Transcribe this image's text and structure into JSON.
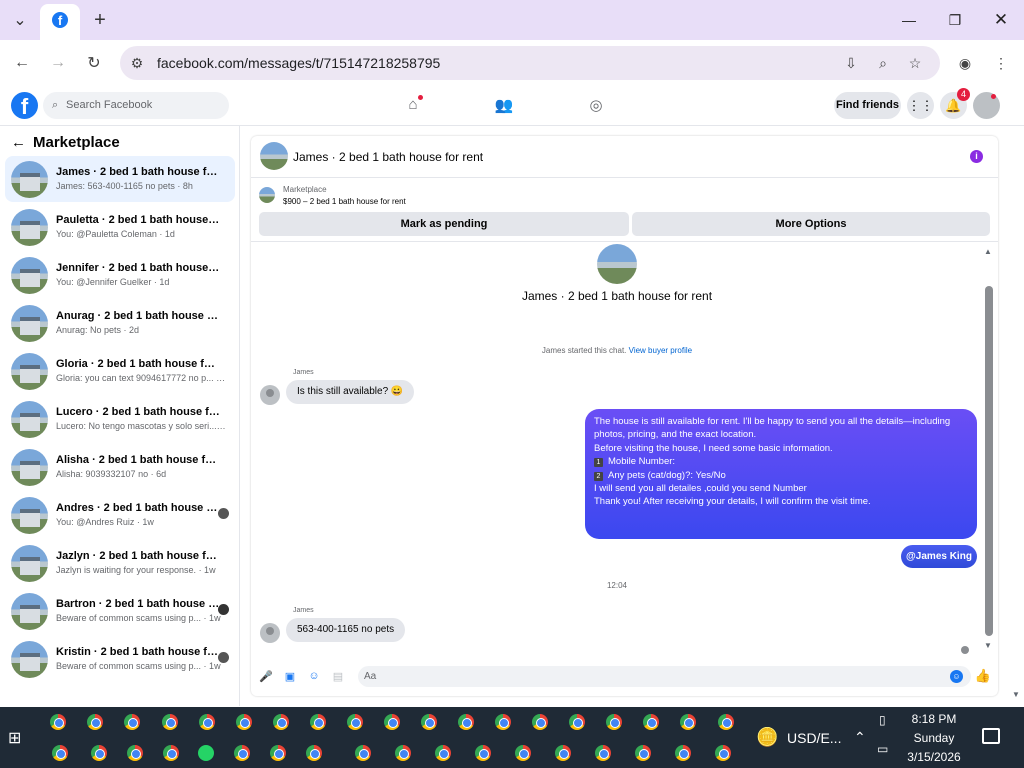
{
  "browser": {
    "url": "facebook.com/messages/t/715147218258795"
  },
  "fb": {
    "search_placeholder": "Search Facebook",
    "find_friends": "Find friends",
    "notification_count": "4"
  },
  "sidebar": {
    "title": "Marketplace",
    "conversations": [
      {
        "name": "James · 2 bed 1 bath house for rent",
        "preview": "James: 563-400-1165 no pets · 8h"
      },
      {
        "name": "Pauletta · 2 bed 1 bath house for r...",
        "preview": "You: @Pauletta Coleman · 1d"
      },
      {
        "name": "Jennifer · 2 bed 1 bath house for r...",
        "preview": "You: @Jennifer Guelker · 1d"
      },
      {
        "name": "Anurag · 2 bed 1 bath house for rent",
        "preview": "Anurag: No pets · 2d"
      },
      {
        "name": "Gloria · 2 bed 1 bath house for rent",
        "preview": "Gloria: you can text 9094617772 no p... · 5d"
      },
      {
        "name": "Lucero · 2 bed 1 bath house for rent",
        "preview": "Lucero: No tengo mascotas y solo seri... · 6d"
      },
      {
        "name": "Alisha · 2 bed 1 bath house for rent",
        "preview": "Alisha: 9039332107 no · 6d"
      },
      {
        "name": "Andres · 2 bed 1 bath house for ...",
        "preview": "You: @Andres Ruiz · 1w"
      },
      {
        "name": "Jazlyn · 2 bed 1 bath house for rent",
        "preview": "Jazlyn is waiting for your response. · 1w"
      },
      {
        "name": "Bartron · 2 bed 1 bath house for ...",
        "preview": "Beware of common scams using p... · 1w"
      },
      {
        "name": "Kristin · 2 bed 1 bath house for r...",
        "preview": "Beware of common scams using p... · 1w"
      }
    ]
  },
  "chat": {
    "title": "James · 2 bed 1 bath house for rent",
    "marketplace_label": "Marketplace",
    "listing": "$900 – 2 bed 1 bath house for rent",
    "mark_pending": "Mark as pending",
    "more_options": "More Options",
    "center_name": "James · 2 bed 1 bath house for rent",
    "start_note": "James started this chat.",
    "view_profile": "View buyer profile",
    "sender_name": "James",
    "msg1": "Is this still available? 😀",
    "out_lines": [
      "The house is still available for rent. I'll be happy to send you all the details—including",
      "photos, pricing, and the exact location.",
      "",
      "Before visiting the house, I need some basic information.",
      "Mobile Number:",
      "Any pets (cat/dog)?: Yes/No",
      "",
      "I will send you all detailes ,could you send Number",
      "Thank you! After receiving your details, I will confirm the visit time."
    ],
    "mention": "@James King",
    "timestamp": "12:04",
    "msg2": "563-400-1165  no pets",
    "input_placeholder": "Aa"
  },
  "taskbar": {
    "currency": "USD/E...",
    "time": "8:18 PM",
    "day": "Sunday",
    "date": "3/15/2026"
  }
}
